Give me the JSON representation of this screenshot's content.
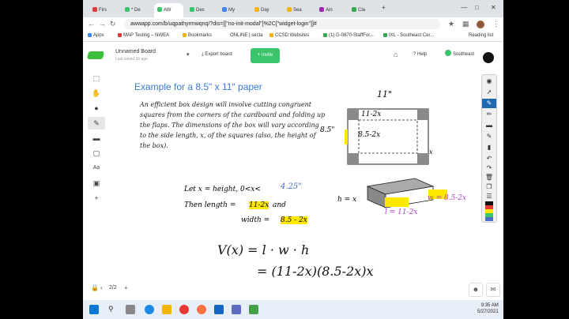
{
  "browser": {
    "tabs": [
      {
        "label": "Firs",
        "color": "#e53935"
      },
      {
        "label": "* De",
        "color": "#3cc46a"
      },
      {
        "label": "AW",
        "color": "#3cc46a",
        "active": true
      },
      {
        "label": "Des",
        "color": "#3cc46a"
      },
      {
        "label": "My",
        "color": "#4285f4"
      },
      {
        "label": "Day",
        "color": "#f4b400"
      },
      {
        "label": "Sea",
        "color": "#f4b400"
      },
      {
        "label": "Ain",
        "color": "#9c27b0"
      },
      {
        "label": "Cla",
        "color": "#34a853"
      }
    ],
    "new_tab": "+",
    "url": "awwapp.com/b/uqpathyrmwqnq/?dis=[[\"no-init-modal\"]%2C[\"widget-login\"]]#",
    "bookmarks": [
      "Apps",
      "MAP Testing – NWEA",
      "Bookmarks",
      "ONLINE | secta",
      "CCSD Websites",
      "(1) G-0870-StaffFor...",
      "IXL - Southeast Cer...",
      "Reading list"
    ]
  },
  "header": {
    "board_name": "Unnamed Board",
    "last_saved": "Last saved 1h ago",
    "export_label": "Export board",
    "invite_label": "Invite",
    "help_label": "Help",
    "user_label": "Southeast"
  },
  "left_tools": [
    "select",
    "hand",
    "palette",
    "pen",
    "eraser",
    "shape",
    "text",
    "sticky-note",
    "add"
  ],
  "annotation_tools": [
    "eye",
    "arrow",
    "pen",
    "marker",
    "eraser",
    "pencil",
    "highlighter",
    "undo",
    "redo",
    "trash",
    "copy",
    "list"
  ],
  "swatches": [
    "#111111",
    "#e53935",
    "#ffe800",
    "#3cc46a",
    "#b040c8",
    "#4a70c8"
  ],
  "page": {
    "title": "Example for a 8.5\" x 11\" paper",
    "problem_text": "An efficient box design will involve cutting congruent squares from the corners of the cardboard and folding up the flaps. The dimensions of the box will vary according to the side length, x, of the squares (also, the height of the box).",
    "let_line": "Let  x = height,  0<x<",
    "let_value": "4.25\"",
    "then_line": "Then length =",
    "length_expr": "11-2x",
    "and_word": "and",
    "width_line": "width =",
    "width_expr": "8.5 - 2x",
    "dim_top": "11\"",
    "dim_inner_top": "11-2x",
    "dim_inner_side": "8.5-2x",
    "dim_side": "8.5\"",
    "x_label": "x",
    "h_label": "h = x",
    "l_label": "l = 11-2x",
    "w_label": "w = 8.5-2x",
    "volume_line1": "V(x) = l · w · h",
    "volume_line2": "= (11-2x)(8.5-2x)x"
  },
  "bottom": {
    "page_num": "2",
    "page_total": "/2"
  },
  "taskbar": {
    "time": "9:35 AM",
    "date": "5/27/2021"
  }
}
